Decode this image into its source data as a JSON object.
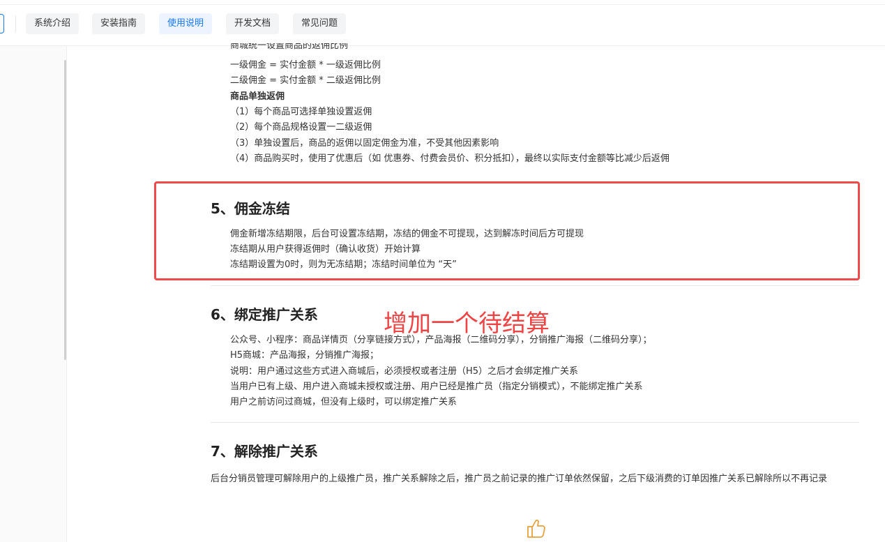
{
  "nav": {
    "tabs": [
      {
        "label": "系统介绍"
      },
      {
        "label": "安装指南"
      },
      {
        "label": "使用说明"
      },
      {
        "label": "开发文档"
      },
      {
        "label": "常见问题"
      }
    ],
    "active_index": 2
  },
  "section4": {
    "clipped_line": "商城统一设置商品的返佣比例",
    "lines": [
      "一级佣金 = 实付金额 * 一级返佣比例",
      "二级佣金 = 实付金额 * 二级返佣比例"
    ],
    "subheading": "商品单独返佣",
    "items": [
      "（1）每个商品可选择单独设置返佣",
      "（2）每个商品规格设置一二级返佣",
      "（3）单独设置后，商品的返佣以固定佣金为准，不受其他因素影响",
      "（4）商品购买时，使用了优惠后（如 优惠券、付费会员价、积分抵扣），最终以实际支付金额等比减少后返佣"
    ]
  },
  "section5": {
    "title": "5、佣金冻结",
    "lines": [
      "佣金新增冻结期限，后台可设置冻结期，冻结的佣金不可提现，达到解冻时间后方可提现",
      "冻结期从用户获得返佣时（确认收货）开始计算",
      "冻结期设置为0时，则为无冻结期；冻结时间单位为 “天”"
    ]
  },
  "annotation": "增加一个待结算",
  "section6": {
    "title": "6、绑定推广关系",
    "lines": [
      "公众号、小程序：商品详情页（分享链接方式），产品海报（二维码分享），分销推广海报（二维码分享）；",
      "H5商城：产品海报，分销推广海报；",
      "说明：用户通过这些方式进入商城后，必须授权或者注册（H5）之后才会绑定推广关系",
      "当用户已有上级、用户进入商城未授权或注册、用户已经是推广员（指定分销模式），不能绑定推广关系",
      "用户之前访问过商城，但没有上级时，可以绑定推广关系"
    ]
  },
  "section7": {
    "title": "7、解除推广关系",
    "paragraph": "后台分销员管理可解除用户的上级推广员，推广关系解除之后，推广员之前记录的推广订单依然保留，之后下级消费的订单因推广关系已解除所以不再记录"
  },
  "icons": {
    "like": "thumbs-up-icon"
  },
  "colors": {
    "accent": "#1677ff",
    "highlight": "#ef4a4a",
    "annotation": "#ef4444"
  }
}
